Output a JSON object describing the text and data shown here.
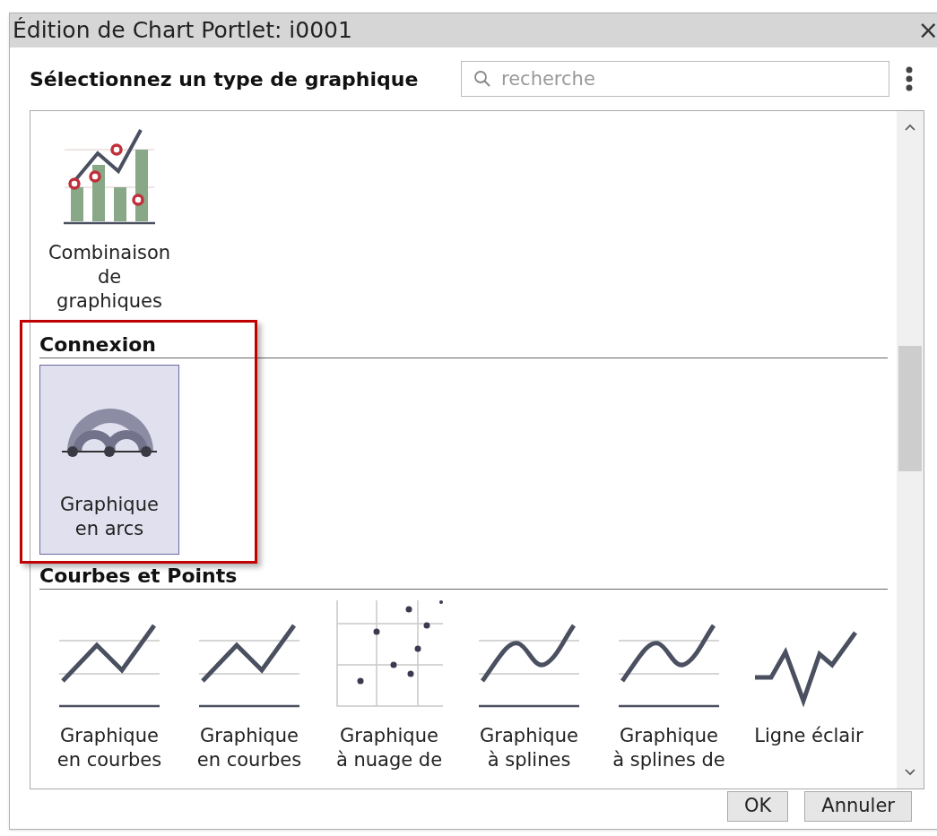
{
  "window": {
    "title": "Édition de Chart Portlet: i0001",
    "close": "×"
  },
  "header": {
    "title": "Sélectionnez un type de graphique",
    "search": {
      "placeholder": "recherche"
    }
  },
  "sections": [
    {
      "items": [
        {
          "label": [
            "Combinaison",
            "de",
            "graphiques"
          ],
          "kind": "combo",
          "selected": false
        }
      ]
    },
    {
      "title": "Connexion",
      "highlighted": true,
      "items": [
        {
          "label": [
            "Graphique",
            "en arcs"
          ],
          "kind": "arc",
          "selected": true
        }
      ]
    },
    {
      "title": "Courbes et Points",
      "highlighted": false,
      "items": [
        {
          "label": [
            "Graphique",
            "en courbes"
          ],
          "kind": "line",
          "selected": false
        },
        {
          "label": [
            "Graphique",
            "en courbes"
          ],
          "kind": "line",
          "selected": false
        },
        {
          "label": [
            "Graphique",
            "à nuage de"
          ],
          "kind": "scatter",
          "selected": false
        },
        {
          "label": [
            "Graphique",
            "à splines"
          ],
          "kind": "spline",
          "selected": false
        },
        {
          "label": [
            "Graphique",
            "à splines de"
          ],
          "kind": "spline",
          "selected": false
        },
        {
          "label": [
            "Ligne éclair"
          ],
          "kind": "spark",
          "selected": false
        }
      ]
    }
  ],
  "buttons": [
    "OK",
    "Annuler"
  ]
}
